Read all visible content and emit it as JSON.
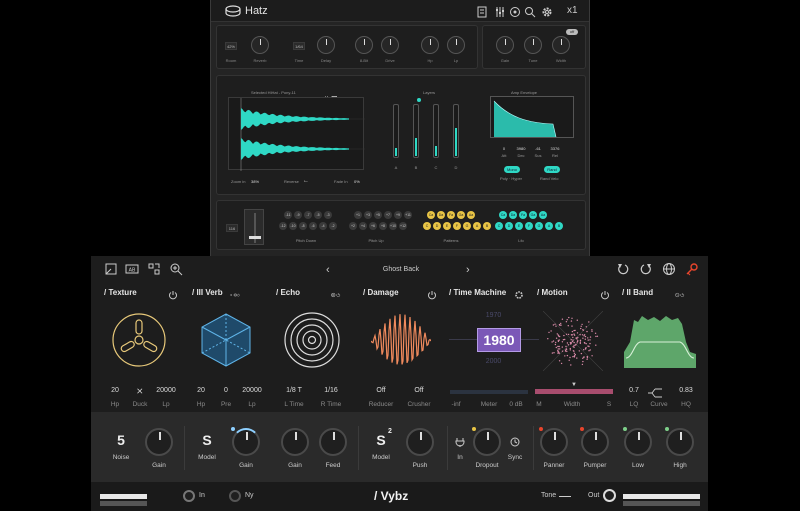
{
  "hatz": {
    "title": "Hatz",
    "header_right_text": "x1",
    "knobs": [
      {
        "label": "Room"
      },
      {
        "label": "Reverb"
      },
      {
        "label": "Time"
      },
      {
        "label": "Delay"
      },
      {
        "label": "8-Bit"
      },
      {
        "label": "Drive"
      },
      {
        "label": "Hp"
      },
      {
        "label": "Lp"
      },
      {
        "label": "Gain"
      },
      {
        "label": "Tune"
      },
      {
        "label": "Width"
      }
    ],
    "room_value": "42%",
    "time_value": "1/64",
    "width_badge": "off",
    "sample_label": "Selected HiHat - Pony-11",
    "zoom_label": "Zoom in",
    "zoom_value": "38%",
    "reverse_label": "Reverse",
    "fade_label": "Fade In",
    "fade_value": "0%",
    "layers_label": "Layers",
    "layer_names": [
      "A",
      "B",
      "C",
      "D"
    ],
    "layer_levels": [
      0.15,
      0.35,
      0.2,
      0.55
    ],
    "env_title": "Amp Envelope",
    "env_values": [
      "0",
      "3980",
      "-61",
      "3376"
    ],
    "env_labels": [
      "Att",
      "Dec",
      "Sus",
      "Rel"
    ],
    "env_btn1": "Mono",
    "env_btn2": "Rand",
    "env_sub1": "Poly · Hyper",
    "env_sub2": "Rand Velo",
    "seq_value": "116",
    "seq_group_labels": [
      "Pitch Down",
      "Pitch Up",
      "Patterns",
      "Lfo"
    ],
    "pitch_down_top": [
      "-11",
      "-9",
      "-7",
      "-5",
      "-3"
    ],
    "pitch_up_top": [
      "+1",
      "+3",
      "+5",
      "+7",
      "+9",
      "+11"
    ],
    "pitch_down_bottom": [
      "-12",
      "-10",
      "-8",
      "-6",
      "-4",
      "-2"
    ],
    "pitch_up_bottom": [
      "+2",
      "+4",
      "+6",
      "+8",
      "+10",
      "+12"
    ],
    "pattern_top": [
      "Ca",
      "Da",
      "Fa",
      "Ga",
      "Aa"
    ],
    "pattern_bottom": [
      "C",
      "D",
      "E",
      "F",
      "G",
      "A",
      "B"
    ],
    "lfo_top": [
      "Ca",
      "Da",
      "Fa",
      "Ga",
      "Aa"
    ],
    "lfo_bottom": [
      "C",
      "D",
      "E",
      "F",
      "G",
      "A",
      "B"
    ]
  },
  "vybz": {
    "preset_name": "Ghost Back",
    "brand": "/ Vybz",
    "accent": "#e8452c",
    "modules": [
      {
        "title": "/ Texture",
        "values": [
          "20",
          "20000"
        ],
        "labels": [
          "Hp",
          "Duck",
          "Lp"
        ]
      },
      {
        "title": "/ III Verb",
        "values": [
          "20",
          "0",
          "20000"
        ],
        "labels": [
          "Hp",
          "Pre",
          "Lp"
        ]
      },
      {
        "title": "/ Echo",
        "values": [
          "1/8 T",
          "1/16"
        ],
        "labels": [
          "L Time",
          "R Time"
        ]
      },
      {
        "title": "/ Damage",
        "values": [
          "Off",
          "Off"
        ],
        "labels": [
          "Reducer",
          "Crusher"
        ]
      },
      {
        "title": "/ Time Machine",
        "values": [],
        "labels": [
          "-inf",
          "Meter",
          "0 dB"
        ]
      },
      {
        "title": "/ Motion",
        "values": [],
        "labels": [
          "M",
          "Width",
          "S"
        ]
      },
      {
        "title": "/ II Band",
        "values": [
          "0.7",
          "0.83"
        ],
        "labels": [
          "LQ",
          "Curve",
          "HQ"
        ]
      }
    ],
    "time_machine": {
      "year_top": "1970",
      "year_main": "1980",
      "year_bottom": "2000"
    },
    "motion_width": 0.5,
    "bottom": [
      {
        "big": "5",
        "label": "Noise"
      },
      {
        "label": "Gain"
      },
      {
        "big": "S",
        "label": "Model"
      },
      {
        "label": "Gain"
      },
      {
        "label": "Gain"
      },
      {
        "label": "Feed"
      },
      {
        "big": "S",
        "sup": "2",
        "label": "Model"
      },
      {
        "label": "Push"
      },
      {
        "label": "In"
      },
      {
        "label": "Dropout"
      },
      {
        "label": "Sync"
      },
      {
        "label": "Panner"
      },
      {
        "label": "Pumper"
      },
      {
        "label": "Low"
      },
      {
        "label": "High"
      }
    ],
    "footer": {
      "in_label": "In",
      "ny_label": "Ny",
      "tone_label": "Tone",
      "out_label": "Out"
    }
  }
}
